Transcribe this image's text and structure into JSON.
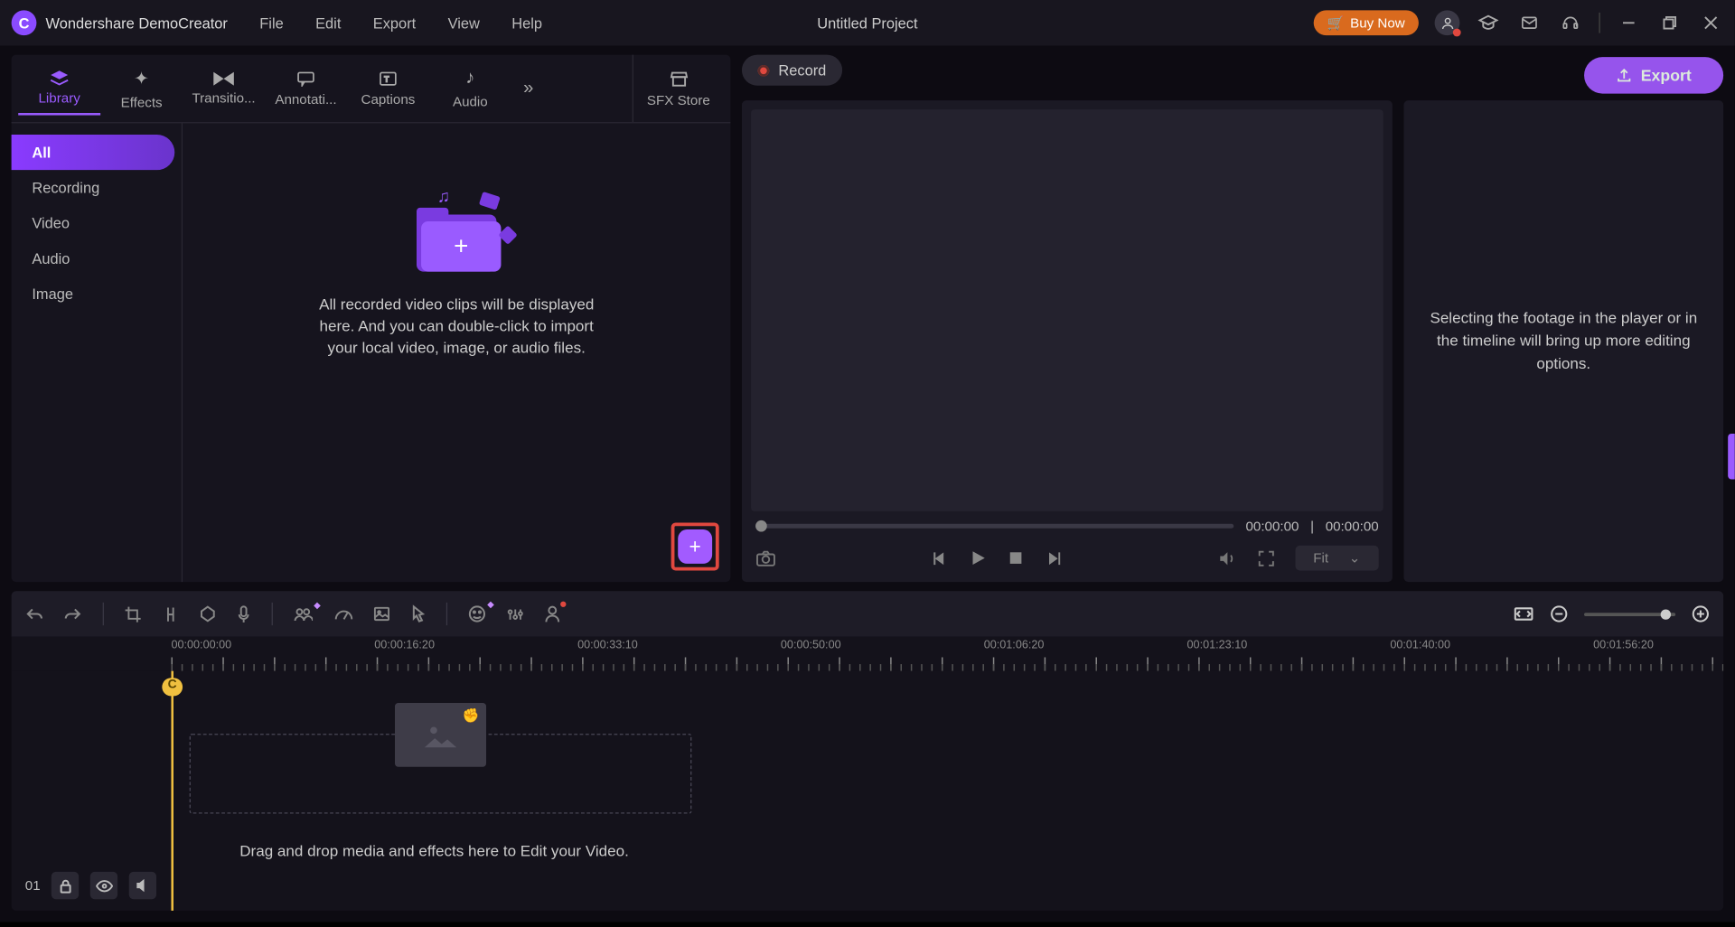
{
  "app": {
    "name": "Wondershare DemoCreator",
    "project_title": "Untitled Project"
  },
  "menu": {
    "file": "File",
    "edit": "Edit",
    "export": "Export",
    "view": "View",
    "help": "Help"
  },
  "titlebar": {
    "buy": "Buy Now"
  },
  "export_btn": "Export",
  "lib_tabs": {
    "library": "Library",
    "effects": "Effects",
    "transitions": "Transitio...",
    "annotations": "Annotati...",
    "captions": "Captions",
    "audio": "Audio",
    "sfx": "SFX Store"
  },
  "lib_side": {
    "all": "All",
    "recording": "Recording",
    "video": "Video",
    "audio": "Audio",
    "image": "Image"
  },
  "lib_message": "All recorded video clips will be displayed here. And you can double-click to import your local video, image, or audio files.",
  "record_label": "Record",
  "preview": {
    "current": "00:00:00",
    "total": "00:00:00",
    "fit": "Fit"
  },
  "options_message": "Selecting the footage in the player or in the timeline will bring up more editing options.",
  "ruler": [
    "00:00:00:00",
    "00:00:16:20",
    "00:00:33:10",
    "00:00:50:00",
    "00:01:06:20",
    "00:01:23:10",
    "00:01:40:00",
    "00:01:56:20"
  ],
  "track": {
    "num": "01"
  },
  "timeline_message": "Drag and drop media and effects here to Edit your Video."
}
